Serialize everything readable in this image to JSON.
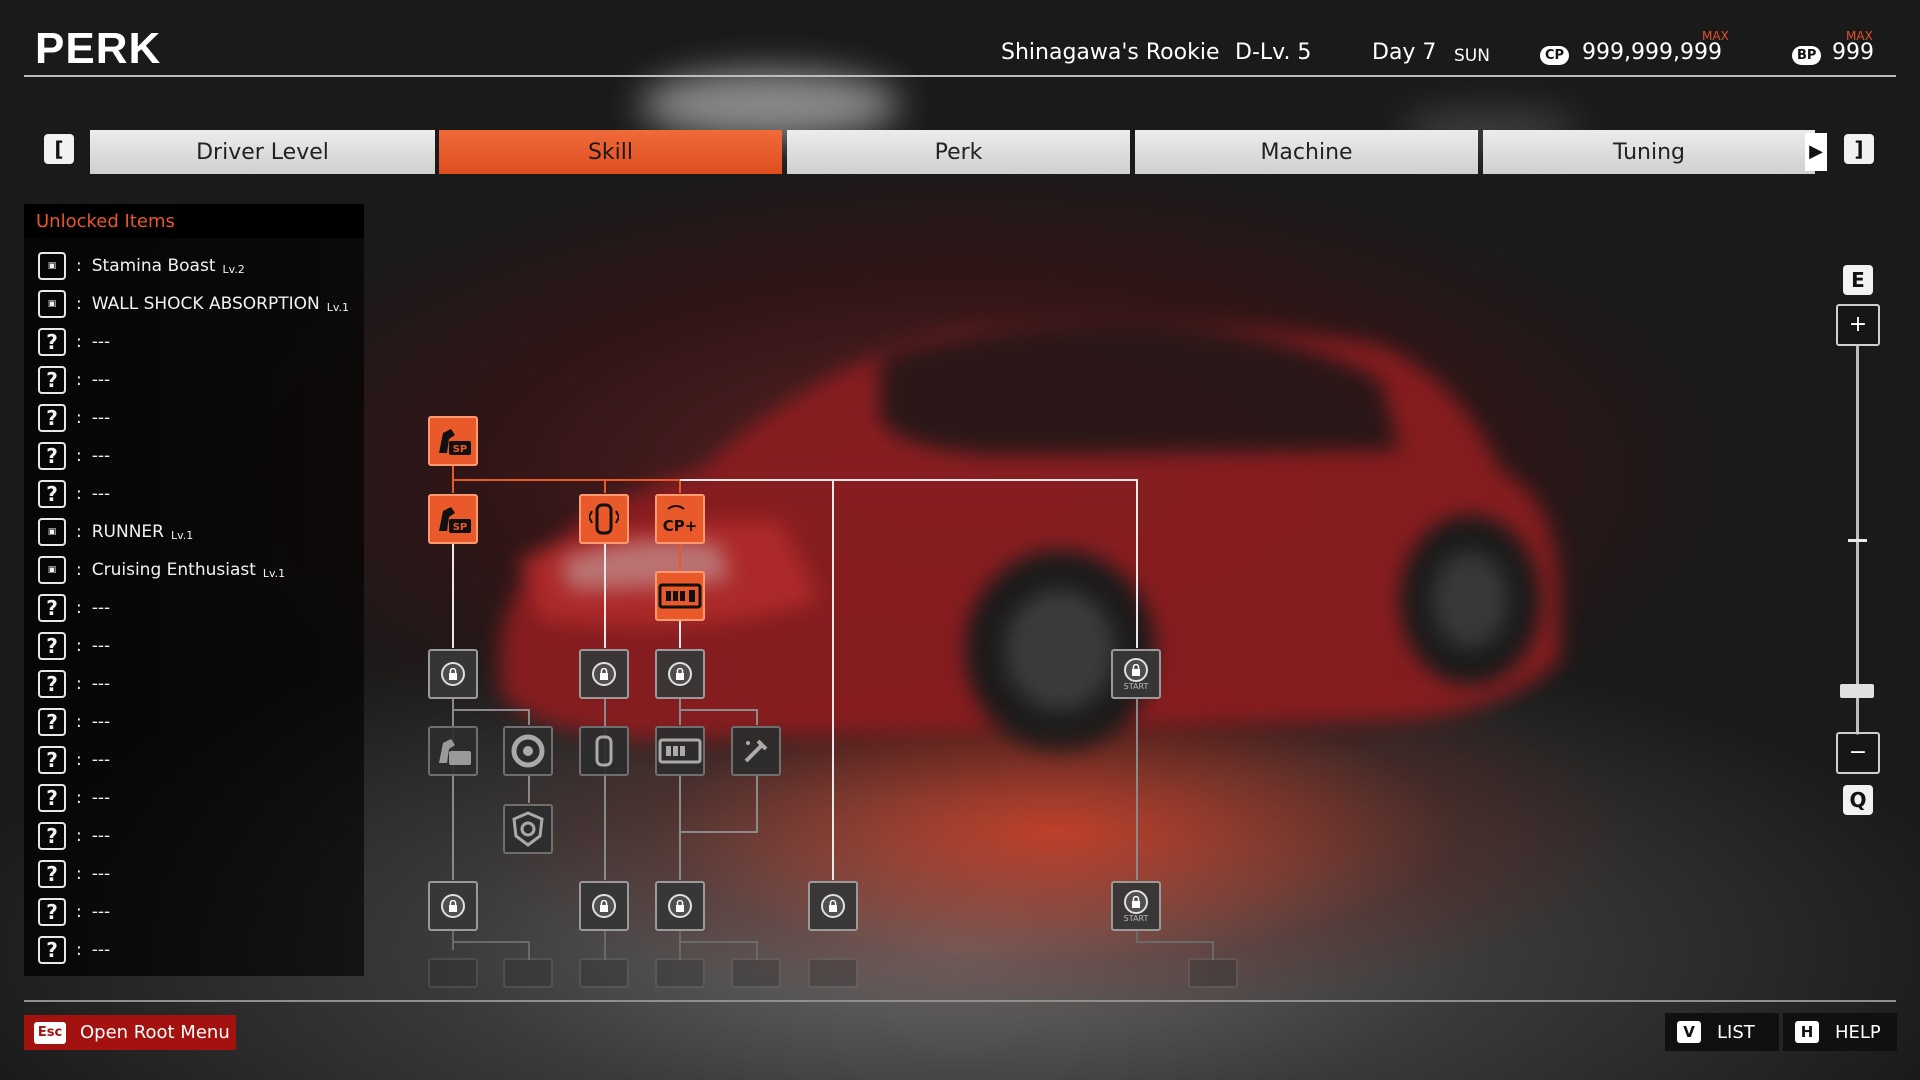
{
  "header": {
    "title": "PERK",
    "driver_title": "Shinagawa's Rookie",
    "driver_level": "D-Lv. 5",
    "day": "Day 7",
    "weekday": "SUN",
    "cp_badge": "CP",
    "cp_value": "999,999,999",
    "cp_max": "MAX",
    "bp_badge": "BP",
    "bp_value": "999",
    "bp_max": "MAX"
  },
  "tabs": {
    "prev_key": "[",
    "next_key": "]",
    "items": [
      {
        "label": "Driver Level",
        "active": false
      },
      {
        "label": "Skill",
        "active": true
      },
      {
        "label": "Perk",
        "active": false
      },
      {
        "label": "Machine",
        "active": false
      },
      {
        "label": "Tuning",
        "active": false
      }
    ]
  },
  "unlocked": {
    "heading": "Unlocked Items",
    "items": [
      {
        "name": "Stamina Boast",
        "level": "Lv.2",
        "icon": "stamina-sp-icon"
      },
      {
        "name": "WALL SHOCK ABSORPTION",
        "level": "Lv.1",
        "icon": "car-shock-icon"
      },
      {
        "name": "---",
        "level": "",
        "icon": "question-icon"
      },
      {
        "name": "---",
        "level": "",
        "icon": "question-icon"
      },
      {
        "name": "---",
        "level": "",
        "icon": "question-icon"
      },
      {
        "name": "---",
        "level": "",
        "icon": "question-icon"
      },
      {
        "name": "---",
        "level": "",
        "icon": "question-icon"
      },
      {
        "name": "RUNNER",
        "level": "Lv.1",
        "icon": "odometer-icon"
      },
      {
        "name": "Cruising Enthusiast",
        "level": "Lv.1",
        "icon": "cp-plus-icon"
      },
      {
        "name": "---",
        "level": "",
        "icon": "question-icon"
      },
      {
        "name": "---",
        "level": "",
        "icon": "question-icon"
      },
      {
        "name": "---",
        "level": "",
        "icon": "question-icon"
      },
      {
        "name": "---",
        "level": "",
        "icon": "question-icon"
      },
      {
        "name": "---",
        "level": "",
        "icon": "question-icon"
      },
      {
        "name": "---",
        "level": "",
        "icon": "question-icon"
      },
      {
        "name": "---",
        "level": "",
        "icon": "question-icon"
      },
      {
        "name": "---",
        "level": "",
        "icon": "question-icon"
      },
      {
        "name": "---",
        "level": "",
        "icon": "question-icon"
      },
      {
        "name": "---",
        "level": "",
        "icon": "question-icon"
      }
    ],
    "colon": ":",
    "question_mark": "?"
  },
  "tree": {
    "node_sp_label": "SP",
    "node_cp_label": "CP+",
    "node_start_label": "START"
  },
  "zoom": {
    "key_up": "E",
    "key_down": "Q",
    "plus": "+",
    "minus": "−",
    "level": 0.05
  },
  "footer": {
    "esc_key": "Esc",
    "esc_label": "Open Root Menu",
    "list_key": "V",
    "list_label": "LIST",
    "help_key": "H",
    "help_label": "HELP"
  },
  "colors": {
    "accent": "#e9592a",
    "highlight_text": "#e8572b",
    "footer_button": "#a4120f"
  }
}
